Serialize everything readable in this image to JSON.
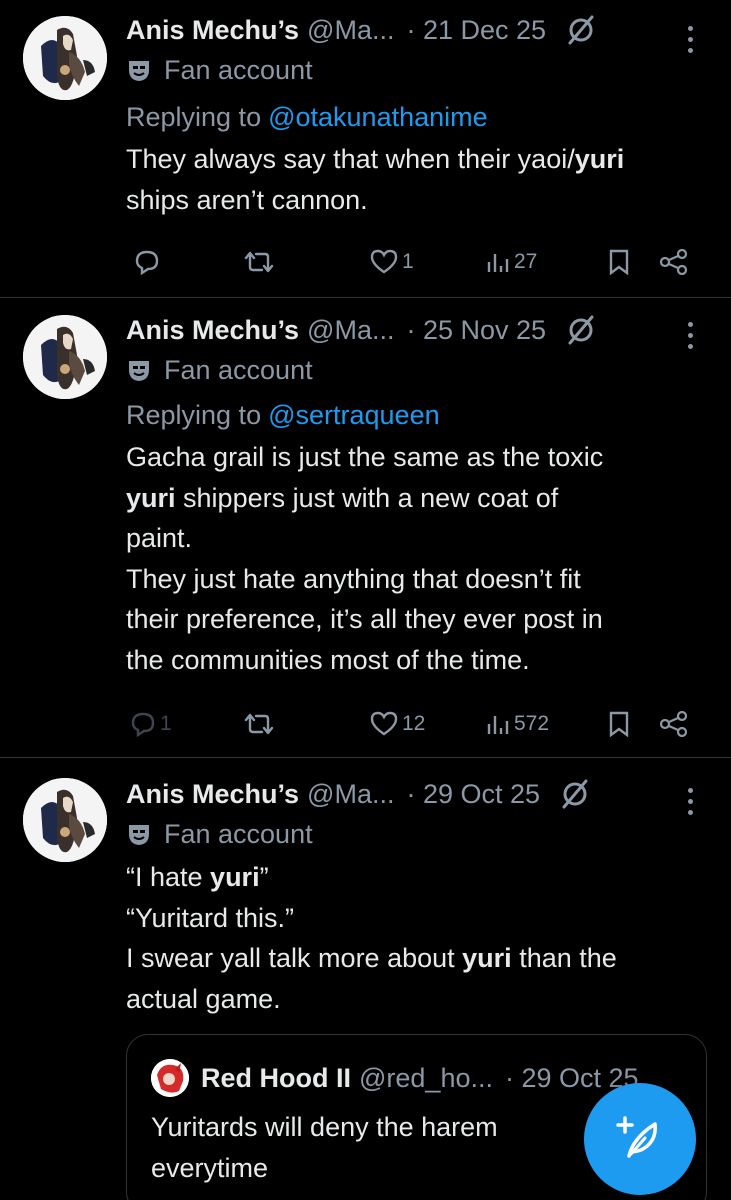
{
  "colors": {
    "background": "#000000",
    "text": "#e7e9ea",
    "muted": "#8b98a5",
    "link": "#1d9bf0",
    "fab": "#1d9bf0"
  },
  "posts": [
    {
      "name": "Anis Mechu’s",
      "handle": "@Ma...",
      "date": "· 21 Dec 25",
      "badge": "Fan account",
      "reply_label": "Replying to",
      "reply_to": "@otakunathanime",
      "text_segments": [
        "They always say that when their yaoi/",
        "yuri",
        "",
        "ships aren’t cannon."
      ],
      "likes": "1",
      "views": "27"
    },
    {
      "name": "Anis Mechu’s",
      "handle": "@Ma...",
      "date": "· 25 Nov 25",
      "badge": "Fan account",
      "reply_label": "Replying to",
      "reply_to": "@sertraqueen",
      "text_segments": [
        "Gacha grail is just the same as the toxic",
        "yuri",
        " shippers just with a new coat of",
        "paint.",
        "They just hate anything that doesn’t fit",
        "their preference, it’s all they ever post in",
        "the communities most of the time."
      ],
      "replies": "1",
      "likes": "12",
      "views": "572"
    },
    {
      "name": "Anis Mechu’s",
      "handle": "@Ma...",
      "date": "· 29 Oct 25",
      "badge": "Fan account",
      "text_segments": [
        "“I hate ",
        "yuri",
        "”",
        "“Yuritard this.”",
        "I swear yall talk more about ",
        "yuri",
        " than the",
        "actual game."
      ],
      "quote": {
        "name": "Red Hood II",
        "handle": "@red_ho...",
        "date": "· 29 Oct 25",
        "text_line1": "Yuritards will deny the harem",
        "text_line2": "everytime"
      }
    }
  ],
  "icons": [
    "more-icon",
    "bird-off-icon",
    "mask-icon",
    "reply-icon",
    "retweet-icon",
    "like-icon",
    "views-icon",
    "bookmark-icon",
    "share-icon",
    "compose-icon"
  ]
}
